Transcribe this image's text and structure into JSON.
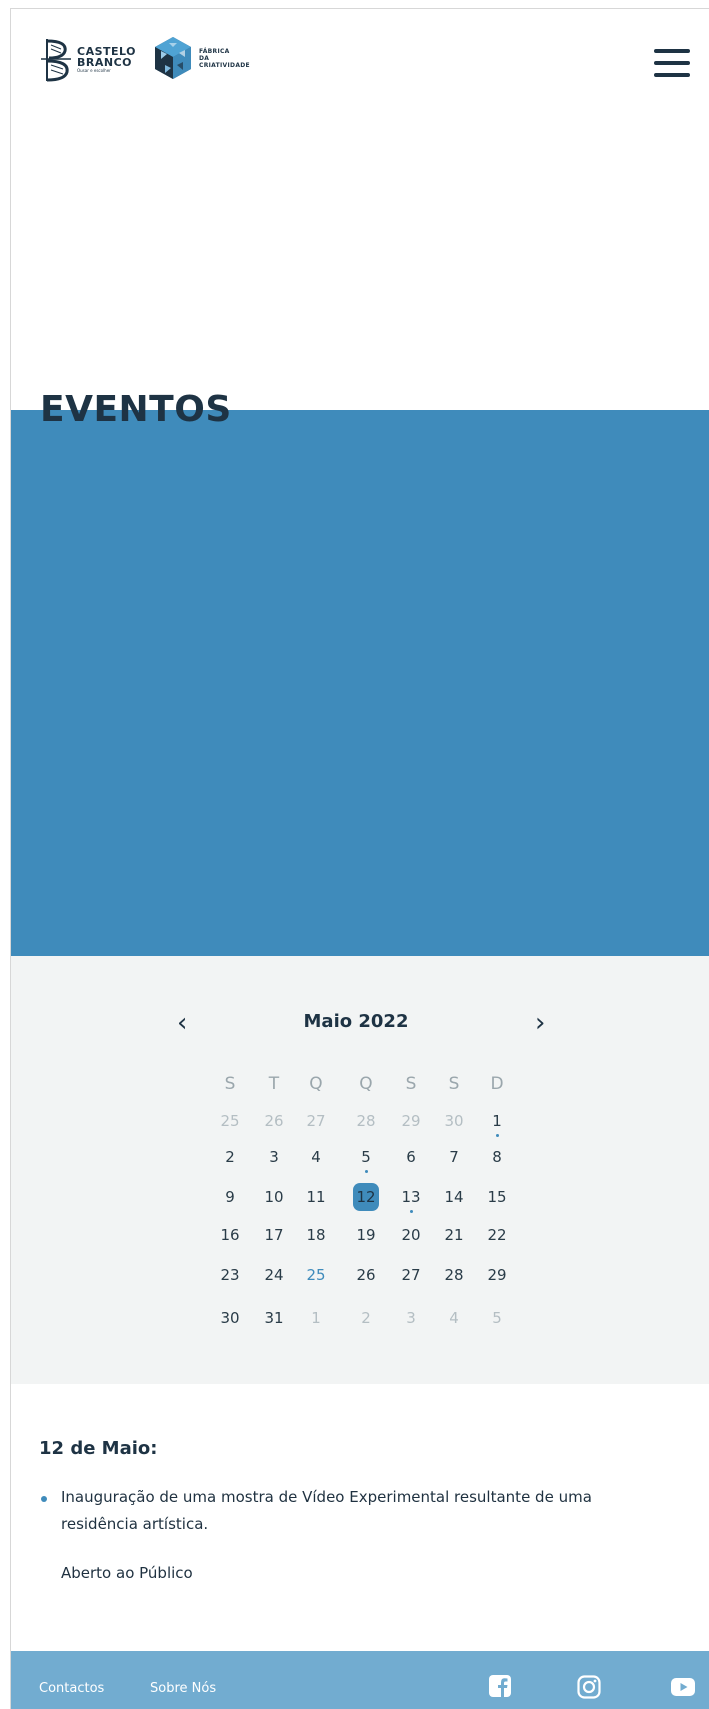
{
  "header": {
    "logo_cb": {
      "line1": "CASTELO",
      "line2": "BRANCO",
      "line3": "Ousar e escolher"
    },
    "logo_fc": {
      "line1": "FÁBRICA",
      "line2": "DA",
      "line3": "CRIATIVIDADE"
    },
    "menu_icon": "hamburger-menu-icon"
  },
  "page": {
    "title": "EVENTOS"
  },
  "colors": {
    "accent": "#3f8bbb",
    "dark": "#1e3344",
    "footer": "#72acd0",
    "calendar_bg": "#f2f4f4"
  },
  "calendar": {
    "prev_label": "‹",
    "next_label": "›",
    "month_label": "Maio 2022",
    "weekdays": [
      "S",
      "T",
      "Q",
      "Q",
      "S",
      "S",
      "D"
    ],
    "weeks": [
      [
        "25",
        "26",
        "27",
        "28",
        "29",
        "30",
        "1"
      ],
      [
        "2",
        "3",
        "4",
        "5",
        "6",
        "7",
        "8"
      ],
      [
        "9",
        "10",
        "11",
        "12",
        "13",
        "14",
        "15"
      ],
      [
        "16",
        "17",
        "18",
        "19",
        "20",
        "21",
        "22"
      ],
      [
        "23",
        "24",
        "25",
        "26",
        "27",
        "28",
        "29"
      ],
      [
        "30",
        "31",
        "1",
        "2",
        "3",
        "4",
        "5"
      ]
    ],
    "selected_day": "12",
    "days_with_events": [
      "1",
      "5",
      "13"
    ],
    "highlighted_day": "25"
  },
  "events": {
    "date_heading": "12 de Maio:",
    "items": [
      "Inauguração de uma mostra de Vídeo Experimental resultante de uma residência artística."
    ],
    "note": "Aberto ao Público"
  },
  "footer": {
    "links": [
      "Contactos",
      "Sobre Nós"
    ],
    "social_icons": [
      "facebook-icon",
      "instagram-icon",
      "youtube-icon"
    ]
  }
}
